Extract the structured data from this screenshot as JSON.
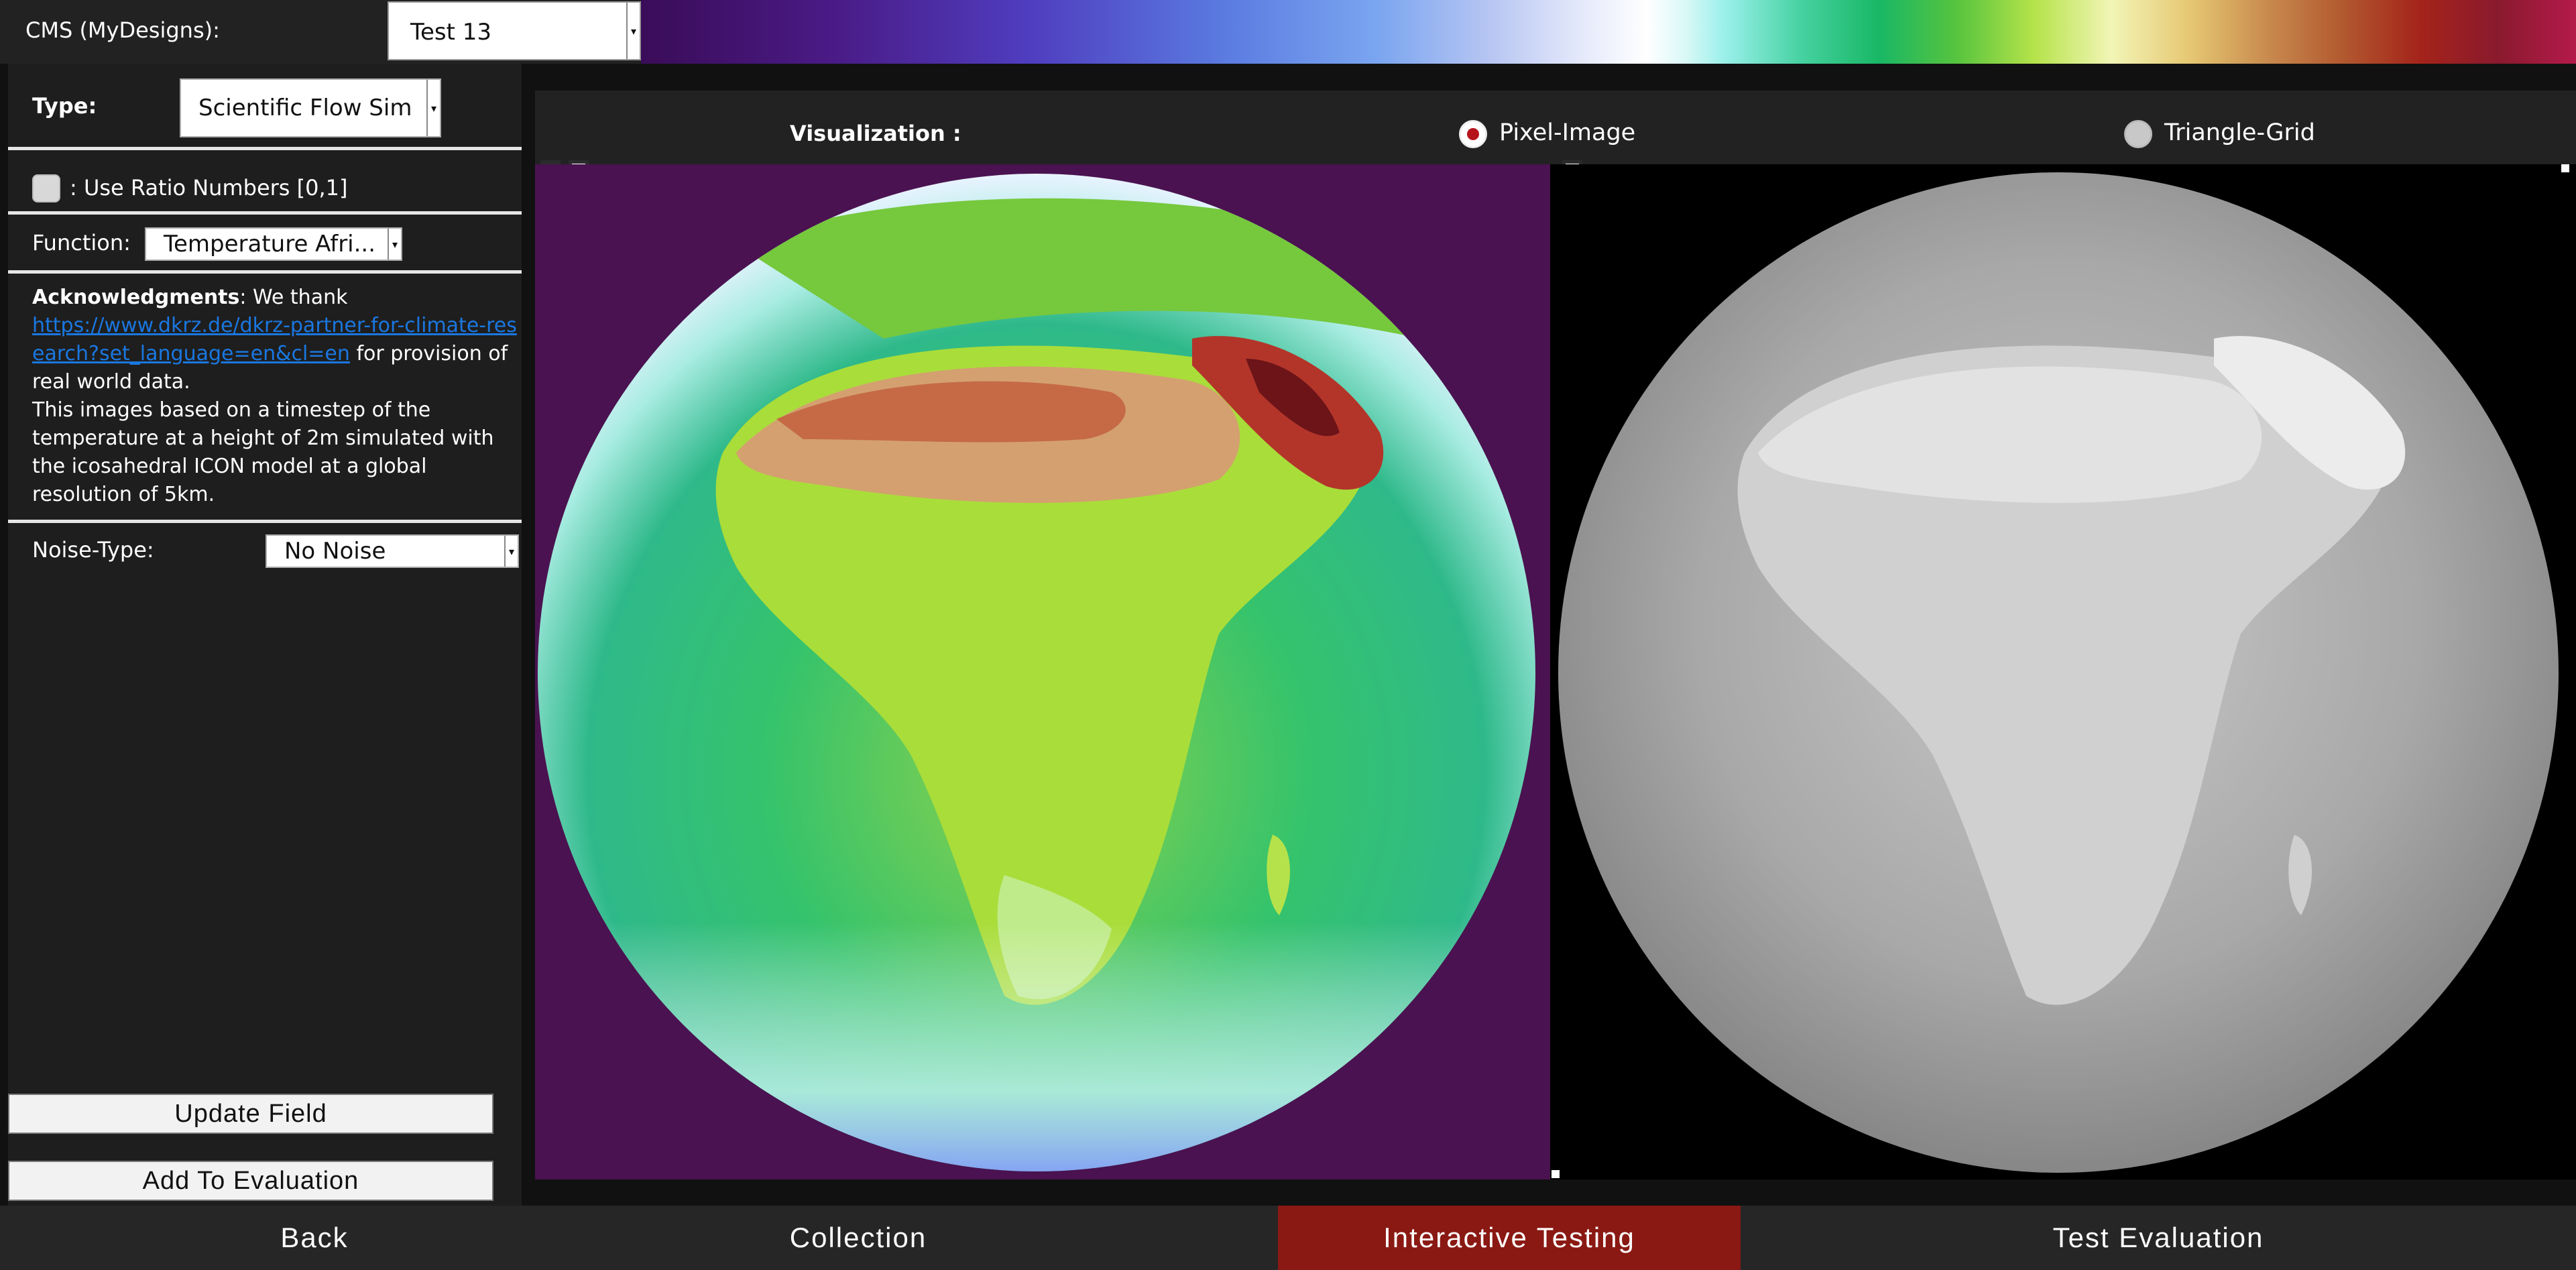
{
  "top_bar": {
    "cms_label": "CMS (MyDesigns):",
    "cms_value": "Test 13"
  },
  "left_panel": {
    "type_label": "Type:",
    "type_value": "Scientific Flow Sim",
    "ratio_label": ": Use Ratio Numbers [0,1]",
    "function_label": "Function:",
    "function_value": "Temperature Afri...",
    "ack_title": "Acknowledgments",
    "ack_intro": ": We thank",
    "ack_link": "https://www.dkrz.de/dkrz-partner-for-climate-research?set_language=en&cl=en",
    "ack_after_link": " for provision of real world data.",
    "ack_body": "This images based on a timestep of the temperature at a height of 2m simulated with the icosahedral ICON model at a global resolution of 5km.",
    "noise_label": "Noise-Type:",
    "noise_value": "No Noise",
    "update_button": "Update Field",
    "add_button": "Add To Evaluation"
  },
  "visualization": {
    "label": "Visualization :",
    "options": [
      {
        "label": "Pixel-Image",
        "selected": true
      },
      {
        "label": "Triangle-Grid",
        "selected": false
      }
    ]
  },
  "images": {
    "left": "Colored temperature field over Africa on a globe",
    "right": "Grayscale temperature field over Africa on a globe"
  },
  "bottom_nav": {
    "tabs": [
      {
        "label": "Back",
        "active": false
      },
      {
        "label": "Collection",
        "active": false
      },
      {
        "label": "Interactive Testing",
        "active": true
      },
      {
        "label": "Test Evaluation",
        "active": false
      }
    ]
  },
  "colors": {
    "accent_active_tab": "#8a1913",
    "radio_selected": "#b5141b",
    "link": "#1a77e0"
  }
}
